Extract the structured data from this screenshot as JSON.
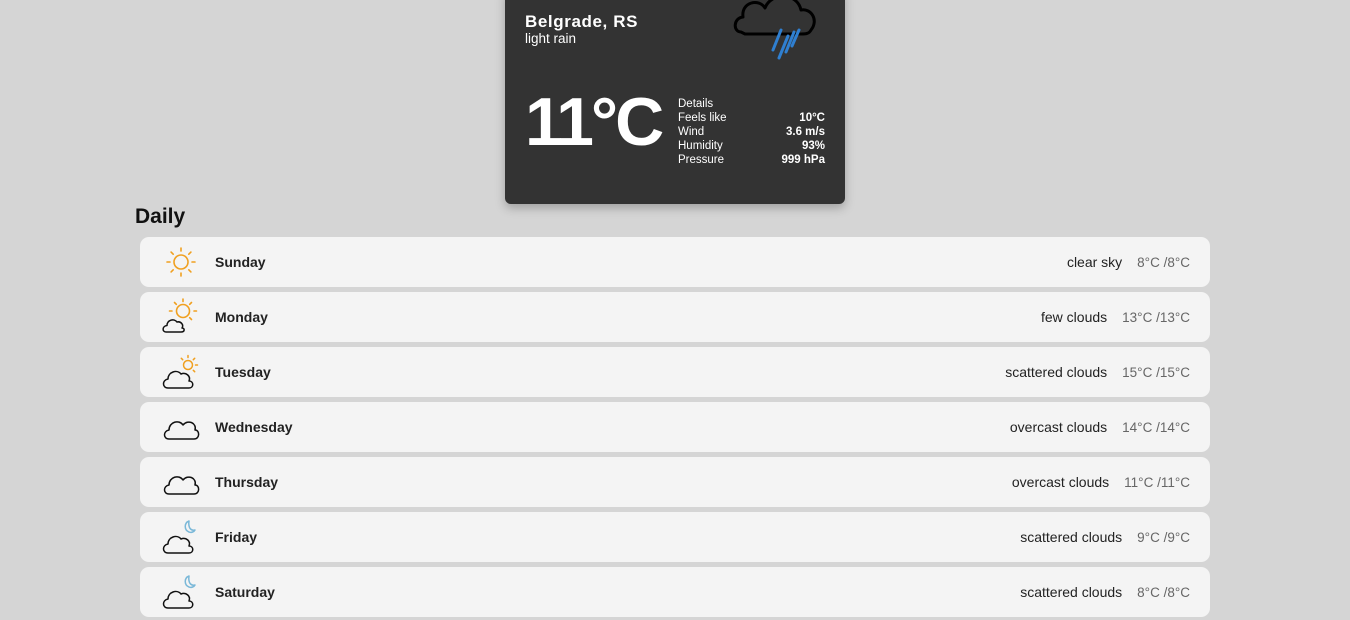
{
  "current": {
    "city": "Belgrade, RS",
    "description": "light rain",
    "temperature": "11°C",
    "icon": "rain-cloud-icon",
    "details_title": "Details",
    "details": [
      {
        "label": "Feels like",
        "value": "10°C"
      },
      {
        "label": "Wind",
        "value": "3.6 m/s"
      },
      {
        "label": "Humidity",
        "value": "93%"
      },
      {
        "label": "Pressure",
        "value": "999 hPa"
      }
    ]
  },
  "daily": {
    "title": "Daily",
    "days": [
      {
        "name": "Sunday",
        "description": "clear sky",
        "temps": "8°C /8°C",
        "icon": "sun-icon"
      },
      {
        "name": "Monday",
        "description": "few clouds",
        "temps": "13°C /13°C",
        "icon": "sun-cloud-icon"
      },
      {
        "name": "Tuesday",
        "description": "scattered clouds",
        "temps": "15°C /15°C",
        "icon": "cloud-sun-icon"
      },
      {
        "name": "Wednesday",
        "description": "overcast clouds",
        "temps": "14°C /14°C",
        "icon": "cloud-icon"
      },
      {
        "name": "Thursday",
        "description": "overcast clouds",
        "temps": "11°C /11°C",
        "icon": "cloud-icon"
      },
      {
        "name": "Friday",
        "description": "scattered clouds",
        "temps": "9°C /9°C",
        "icon": "cloud-moon-icon"
      },
      {
        "name": "Saturday",
        "description": "scattered clouds",
        "temps": "8°C /8°C",
        "icon": "cloud-moon-icon"
      }
    ]
  },
  "colors": {
    "page_background": "#d5d5d5",
    "card_background": "#333333",
    "row_background": "#f4f4f4",
    "rain": "#2f7fd0",
    "sun": "#f0a020",
    "moon": "#7ab8d8"
  }
}
